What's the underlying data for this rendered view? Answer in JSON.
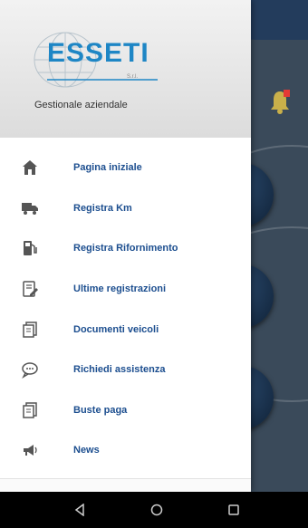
{
  "header": {
    "logo_text": "ESSETI",
    "logo_sub": "S.r.l.",
    "caption": "Gestionale aziendale"
  },
  "menu": {
    "items": [
      {
        "label": "Pagina iniziale",
        "icon": "home-icon"
      },
      {
        "label": "Registra Km",
        "icon": "truck-icon"
      },
      {
        "label": "Registra Rifornimento",
        "icon": "fuel-pump-icon"
      },
      {
        "label": "Ultime registrazioni",
        "icon": "edit-note-icon"
      },
      {
        "label": "Documenti veicoli",
        "icon": "documents-icon"
      },
      {
        "label": "Richiedi assistenza",
        "icon": "chat-bubble-icon"
      },
      {
        "label": "Buste paga",
        "icon": "payslip-icon"
      },
      {
        "label": "News",
        "icon": "megaphone-icon"
      }
    ]
  },
  "navbar": {
    "buttons": [
      "back-icon",
      "home-circle-icon",
      "recents-square-icon"
    ]
  },
  "colors": {
    "brand_blue": "#1e86c5",
    "menu_text": "#1c4e8f",
    "bg_dark": "#233c5c",
    "notification_red": "#e53935",
    "bell_gold": "#c9b04a"
  }
}
